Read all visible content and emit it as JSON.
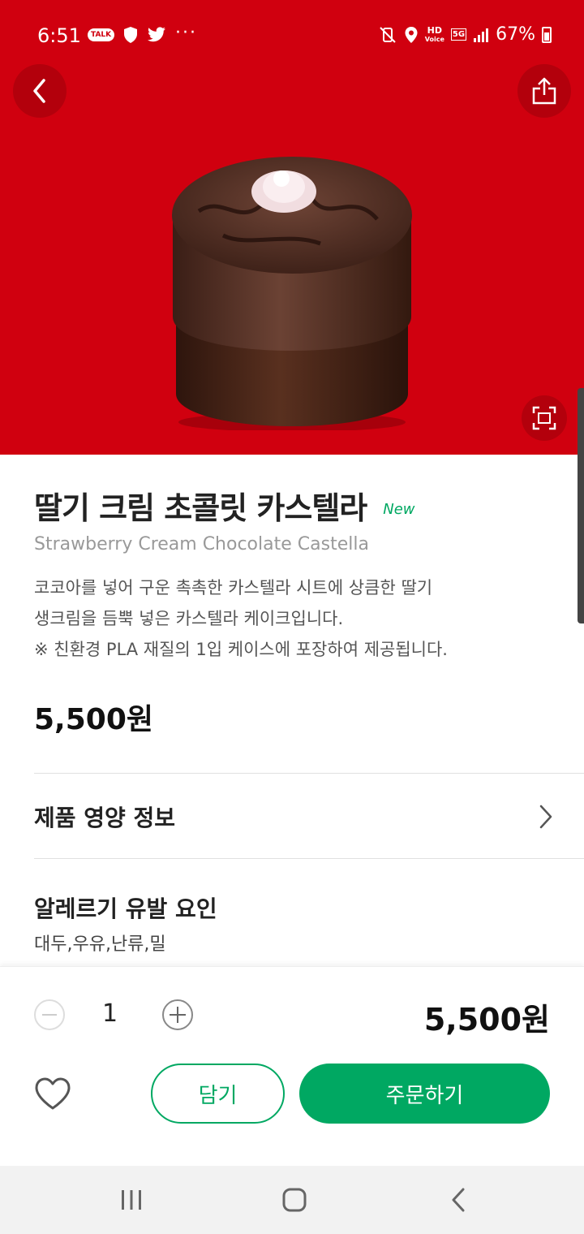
{
  "status_bar": {
    "time": "6:51",
    "talk_label": "TALK",
    "more": "···",
    "hd": "HD",
    "voice": "Voice",
    "network": "5G",
    "battery": "67%"
  },
  "product": {
    "name": "딸기 크림 초콜릿 카스텔라",
    "badge": "New",
    "name_en": "Strawberry Cream Chocolate Castella",
    "description_lines": [
      "코코아를 넣어 구운 촉촉한 카스텔라 시트에 상큼한 딸기",
      "생크림을 듬뿍 넣은 카스텔라 케이크입니다.",
      "※ 친환경 PLA 재질의 1입 케이스에 포장하여 제공됩니다."
    ],
    "price": "5,500원"
  },
  "nutrition": {
    "label": "제품 영양 정보"
  },
  "allergy": {
    "title": "알레르기 유발 요인",
    "value": "대두,우유,난류,밀"
  },
  "order": {
    "quantity": "1",
    "total": "5,500원",
    "cart_label": "담기",
    "order_label": "주문하기"
  },
  "colors": {
    "hero_bg": "#d0000f",
    "accent_green": "#00a862"
  },
  "icons": [
    "back-icon",
    "share-icon",
    "zoom-icon",
    "chevron-right-icon",
    "minus-icon",
    "plus-icon",
    "heart-icon",
    "recents-icon",
    "home-icon",
    "nav-back-icon"
  ]
}
